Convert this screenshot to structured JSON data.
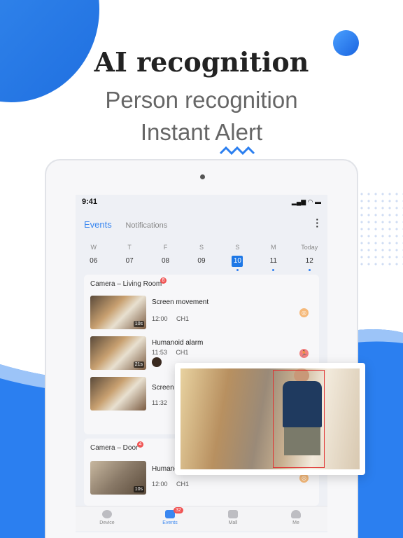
{
  "headline": "AI recognition",
  "sub1": "Person recognition",
  "sub2": "Instant Alert",
  "status": {
    "time": "9:41"
  },
  "tabs": {
    "events": "Events",
    "notifications": "Notifications"
  },
  "days": [
    {
      "w": "W",
      "n": "06",
      "dot": false,
      "sel": false
    },
    {
      "w": "T",
      "n": "07",
      "dot": false,
      "sel": false
    },
    {
      "w": "F",
      "n": "08",
      "dot": false,
      "sel": false
    },
    {
      "w": "S",
      "n": "09",
      "dot": false,
      "sel": false
    },
    {
      "w": "S",
      "n": "10",
      "dot": true,
      "sel": true
    },
    {
      "w": "M",
      "n": "11",
      "dot": true,
      "sel": false
    },
    {
      "w": "Today",
      "n": "12",
      "dot": true,
      "sel": false
    }
  ],
  "cards": [
    {
      "title": "Camera – Living Room",
      "badge": "8",
      "events": [
        {
          "title": "Screen movement",
          "time": "12:00",
          "ch": "CH1",
          "dur": "10s",
          "icon": "motion-icon"
        },
        {
          "title": "Humanoid alarm",
          "time": "11:53",
          "ch": "CH1",
          "dur": "21s",
          "icon": "person-icon"
        },
        {
          "title": "Screen",
          "time": "11:32",
          "ch": "",
          "dur": "",
          "icon": ""
        }
      ]
    },
    {
      "title": "Camera – Door",
      "badge": "4",
      "events": [
        {
          "title": "Humanc",
          "time": "12:00",
          "ch": "CH1",
          "dur": "10s",
          "icon": "motion-icon"
        }
      ]
    }
  ],
  "nav": [
    {
      "label": "Device"
    },
    {
      "label": "Events",
      "badge": "32"
    },
    {
      "label": "Mall"
    },
    {
      "label": "Me"
    }
  ],
  "colors": {
    "accent": "#1e78e6",
    "motion": "#f5b97a",
    "person": "#f08080"
  }
}
